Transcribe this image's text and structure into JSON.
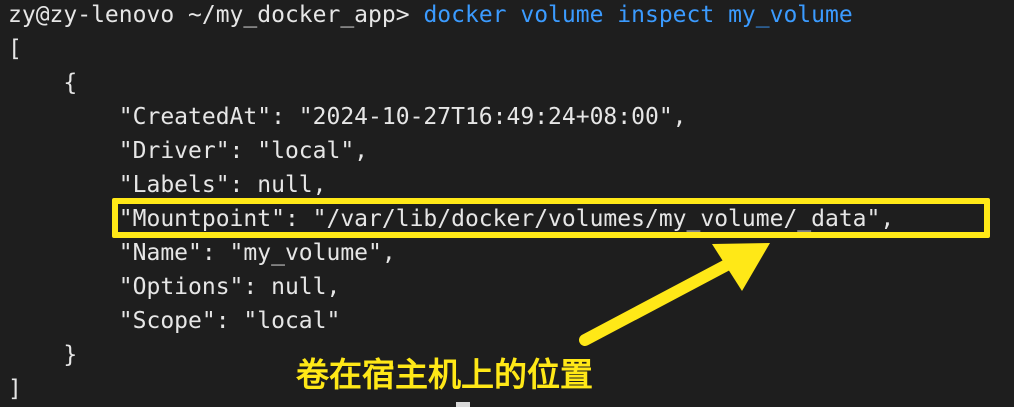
{
  "terminal": {
    "prompt": "zy@zy-lenovo ~/my_docker_app>",
    "command": "docker volume inspect my_volume",
    "output_lines": [
      "[",
      "    {",
      "        \"CreatedAt\": \"2024-10-27T16:49:24+08:00\",",
      "        \"Driver\": \"local\",",
      "        \"Labels\": null,",
      "        \"Mountpoint\": \"/var/lib/docker/volumes/my_volume/_data\",",
      "        \"Name\": \"my_volume\",",
      "        \"Options\": null,",
      "        \"Scope\": \"local\"",
      "    }",
      "]"
    ]
  },
  "annotation": {
    "text": "卷在宿主机上的位置"
  },
  "colors": {
    "background": "#1e1e1e",
    "text": "#e6e6e6",
    "command": "#3b9bff",
    "highlight": "#ffe817"
  }
}
